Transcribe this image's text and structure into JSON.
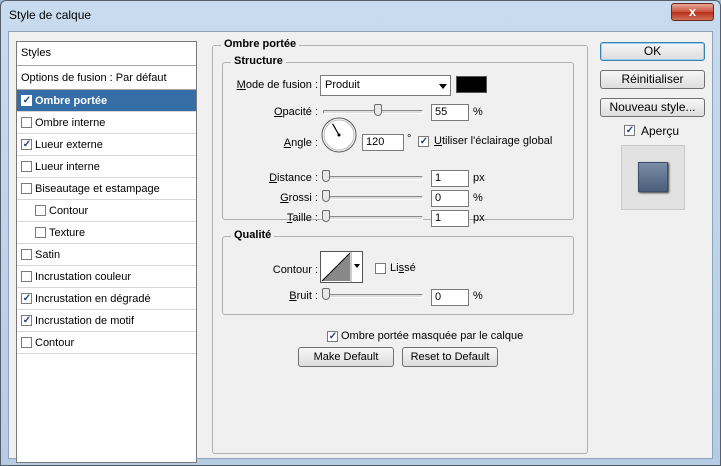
{
  "window": {
    "title": "Style de calque",
    "close_label": "x"
  },
  "styles_panel": {
    "header": "Styles",
    "fusion_option": "Options de fusion : Par défaut",
    "items": [
      {
        "label": "Ombre portée",
        "checked": true,
        "selected": true,
        "indent": false
      },
      {
        "label": "Ombre interne",
        "checked": false,
        "selected": false,
        "indent": false
      },
      {
        "label": "Lueur externe",
        "checked": true,
        "selected": false,
        "indent": false
      },
      {
        "label": "Lueur interne",
        "checked": false,
        "selected": false,
        "indent": false
      },
      {
        "label": "Biseautage et estampage",
        "checked": false,
        "selected": false,
        "indent": false
      },
      {
        "label": "Contour",
        "checked": false,
        "selected": false,
        "indent": true
      },
      {
        "label": "Texture",
        "checked": false,
        "selected": false,
        "indent": true
      },
      {
        "label": "Satin",
        "checked": false,
        "selected": false,
        "indent": false
      },
      {
        "label": "Incrustation couleur",
        "checked": false,
        "selected": false,
        "indent": false
      },
      {
        "label": "Incrustation en dégradé",
        "checked": true,
        "selected": false,
        "indent": false
      },
      {
        "label": "Incrustation de motif",
        "checked": true,
        "selected": false,
        "indent": false
      },
      {
        "label": "Contour",
        "checked": false,
        "selected": false,
        "indent": false
      }
    ]
  },
  "drop_shadow": {
    "section_title": "Ombre portée",
    "structure": {
      "title": "Structure",
      "blend_mode_label": "Mode de fusion :",
      "blend_mode_value": "Produit",
      "shadow_color": "#000000",
      "opacity_label": "Opacité :",
      "opacity_value": "55",
      "opacity_unit": "%",
      "opacity_fraction": 0.55,
      "angle_label": "Angle :",
      "angle_value": "120",
      "angle_unit": "°",
      "global_light_label": "Utiliser l'éclairage global",
      "global_light_checked": true,
      "distance_label": "Distance :",
      "distance_value": "1",
      "distance_unit": "px",
      "spread_label": "Grossi :",
      "spread_value": "0",
      "spread_unit": "%",
      "size_label": "Taille :",
      "size_value": "1",
      "size_unit": "px"
    },
    "quality": {
      "title": "Qualité",
      "contour_label": "Contour :",
      "antialias_label": "Lissé",
      "antialias_checked": false,
      "noise_label": "Bruit :",
      "noise_value": "0",
      "noise_unit": "%"
    },
    "knockout_label": "Ombre portée masquée par le calque",
    "knockout_checked": true,
    "make_default_label": "Make Default",
    "reset_default_label": "Reset to Default"
  },
  "actions": {
    "ok_label": "OK",
    "reset_label": "Réinitialiser",
    "new_style_label": "Nouveau style...",
    "preview_label": "Aperçu",
    "preview_checked": true
  }
}
